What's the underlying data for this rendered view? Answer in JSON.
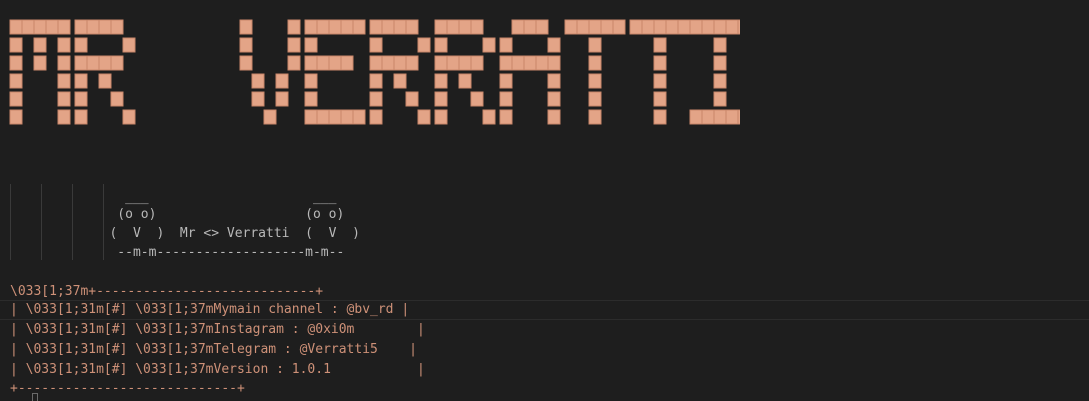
{
  "banner": {
    "text": "MR VERRATTI",
    "color": "#e3a487",
    "shadow_color": "#c8866a"
  },
  "art": {
    "lines": [
      "     ___                     ___",
      "    (o o)                   (o o)",
      "   (  V  )  Mr <> Verratti  (  V  )",
      "    --m-m-------------------m-m--"
    ]
  },
  "console": {
    "lines": [
      "\\033[1;37m+----------------------------+",
      "| \\033[1;31m[#] \\033[1;37mMymain channel : @bv_rd |",
      "| \\033[1;31m[#] \\033[1;37mInstagram : @0xi0m        |",
      "| \\033[1;31m[#] \\033[1;37mTelegram : @Verratti5    |",
      "| \\033[1;31m[#] \\033[1;37mVersion : 1.0.1           |",
      "+----------------------------+"
    ]
  },
  "colors": {
    "background": "#1e1e1e",
    "string_orange": "#ce9178",
    "muted_text": "#b9b9b9"
  }
}
